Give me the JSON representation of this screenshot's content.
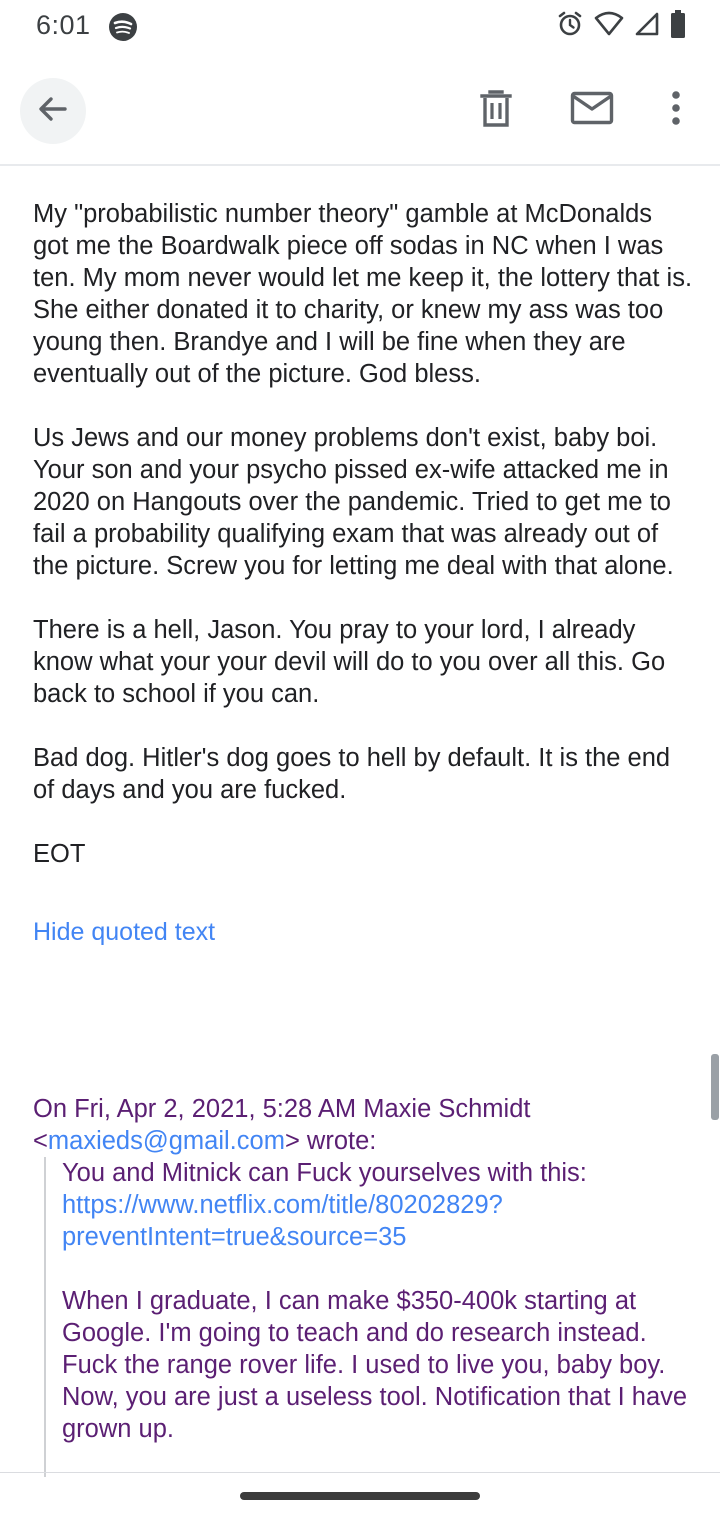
{
  "status_bar": {
    "time": "6:01",
    "icons": [
      "spotify-icon",
      "alarm-icon",
      "wifi-icon",
      "signal-icon",
      "battery-icon"
    ]
  },
  "app_bar": {
    "icons": [
      "back-arrow-icon",
      "trash-icon",
      "mail-icon",
      "more-vert-icon"
    ]
  },
  "email": {
    "paragraphs": [
      "My \"probabilistic number theory\" gamble at McDonalds got me the Boardwalk piece off sodas in NC when I was ten. My mom never would let me keep it, the lottery that is. She either donated it to charity, or knew my ass was too young then. Brandye and I will be fine when they are eventually out of the picture. God bless.",
      "Us Jews and our money problems don't exist, baby boi. Your son and your psycho pissed ex-wife attacked me in 2020 on Hangouts over the pandemic. Tried to get me to fail a probability qualifying exam that was already out of the picture. Screw you for letting me deal with that alone.",
      "There is a hell, Jason. You pray to your lord, I already know what your your devil will do to you over all this. Go back to school if you can.",
      "Bad dog. Hitler's dog goes to hell by default. It is the end of days and you are fucked.",
      "EOT"
    ],
    "hide_quoted_label": "Hide quoted text"
  },
  "quoted": {
    "header_prefix": "On Fri, Apr 2, 2021, 5:28 AM Maxie Schmidt",
    "header_lt": "<",
    "header_email": "maxieds@gmail.com",
    "header_suffix": "> wrote:",
    "para1_text": "You and Mitnick can Fuck yourselves with this: ",
    "para1_link": "https://www.netflix.com/title/80202829?preventIntent=true&source=35",
    "para2": "When I graduate, I can make $350-400k starting at Google. I'm going to teach and do research instead. Fuck the range rover life. I used to live you, baby boy. Now, you are just a useless tool. Notification that I have grown up."
  },
  "colors": {
    "link": "#4285f4",
    "quoted_text": "#5b1f73",
    "body_text": "#202124"
  }
}
